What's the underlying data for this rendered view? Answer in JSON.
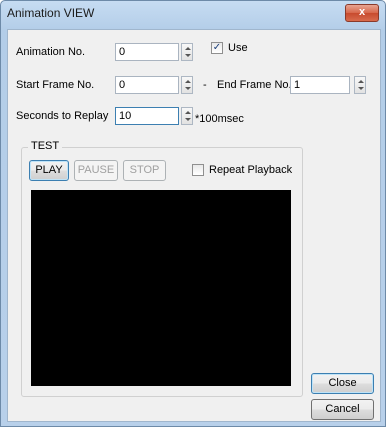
{
  "window": {
    "title": "Animation VIEW",
    "close_glyph": "x"
  },
  "form": {
    "animation_no_label": "Animation No.",
    "animation_no_value": "0",
    "use_label": "Use",
    "use_checked": true,
    "start_frame_label": "Start Frame No.",
    "start_frame_value": "0",
    "range_dash": "-",
    "end_frame_label": "End Frame No.",
    "end_frame_value": "1",
    "seconds_label": "Seconds to Replay",
    "seconds_value": "10",
    "seconds_unit": "*100msec"
  },
  "test_group": {
    "title": "TEST",
    "play_label": "PLAY",
    "pause_label": "PAUSE",
    "stop_label": "STOP",
    "repeat_label": "Repeat Playback",
    "repeat_checked": false
  },
  "footer": {
    "close_label": "Close",
    "cancel_label": "Cancel"
  }
}
